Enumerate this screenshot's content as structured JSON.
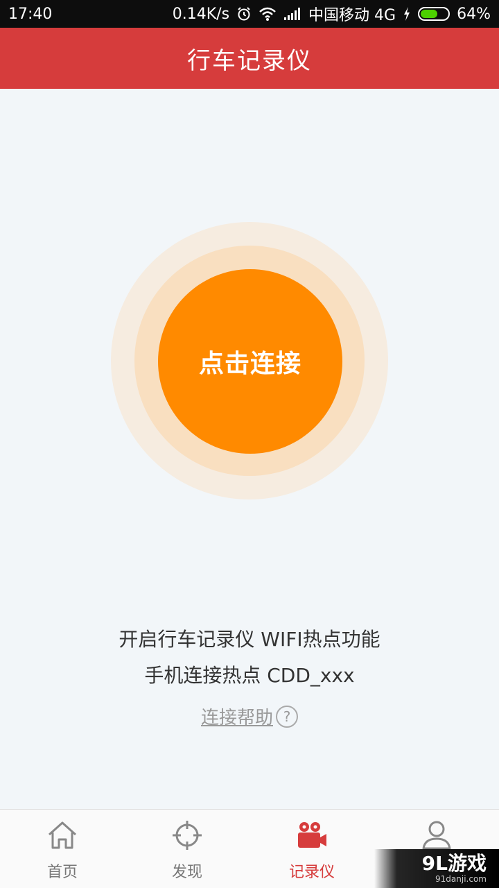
{
  "status_bar": {
    "time": "17:40",
    "speed": "0.14K/s",
    "carrier": "中国移动 4G",
    "battery": "64%",
    "battery_level": 0.64
  },
  "header": {
    "title": "行车记录仪"
  },
  "main": {
    "connect_label": "点击连接",
    "instruction_line1": "开启行车记录仪 WIFI热点功能",
    "instruction_line2": "手机连接热点 CDD_xxx",
    "help_label": "连接帮助",
    "help_icon_glyph": "?"
  },
  "tabs": [
    {
      "label": "首页",
      "icon": "home-icon"
    },
    {
      "label": "发现",
      "icon": "crosshair-icon"
    },
    {
      "label": "记录仪",
      "icon": "video-camera-icon",
      "active": true
    },
    {
      "label": "",
      "icon": "user-icon"
    }
  ],
  "watermark": {
    "main": "9L游戏",
    "sub": "91danji.com"
  },
  "colors": {
    "header_red": "#d63c3c",
    "connect_orange": "#ff8a00",
    "ring_mid": "#f9dfc0",
    "ring_outer": "#f6ece0",
    "active_tab": "#d63c3c"
  }
}
